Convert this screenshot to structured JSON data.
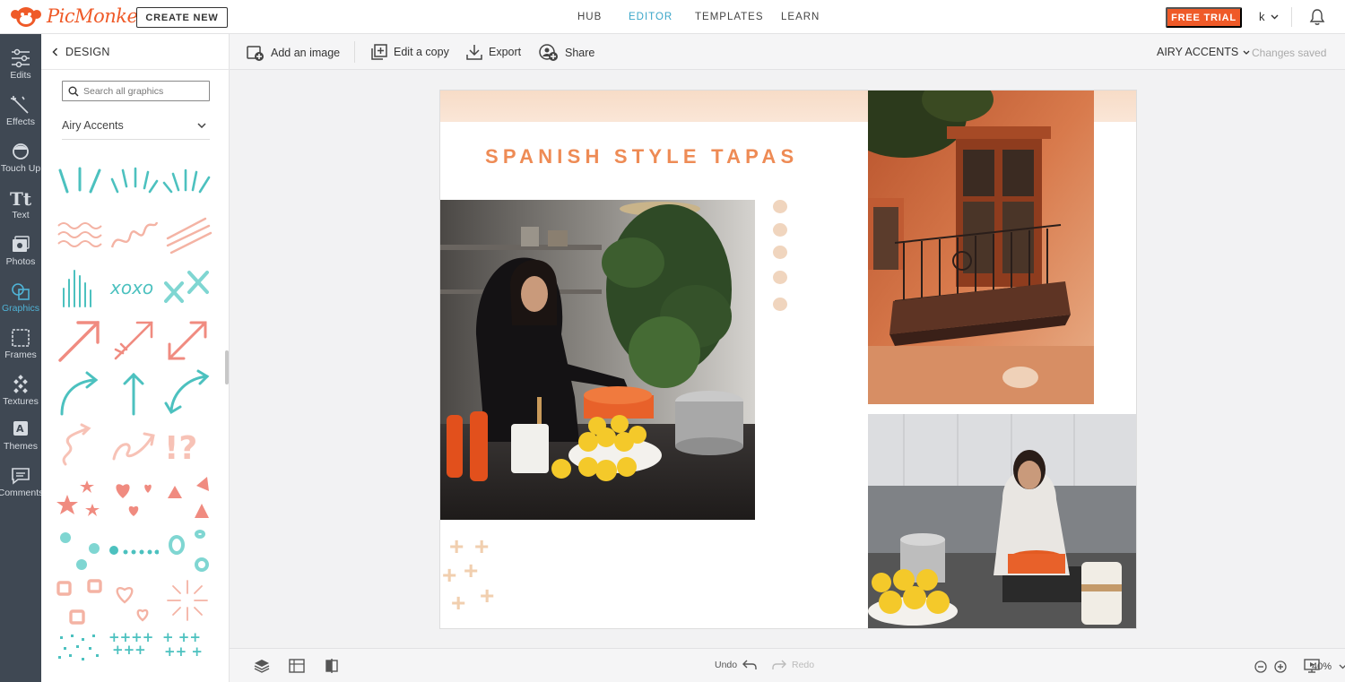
{
  "app": {
    "logo_text": "PicMonkey",
    "brand_color": "#ef5a28",
    "accent_color": "#3aa6c9"
  },
  "topnav": {
    "create_new": "CREATE NEW",
    "links": [
      {
        "label": "HUB",
        "active": false
      },
      {
        "label": "EDITOR",
        "active": true
      },
      {
        "label": "TEMPLATES",
        "active": false
      },
      {
        "label": "LEARN",
        "active": false
      }
    ],
    "free_trial": "FREE TRIAL",
    "user_initial": "k",
    "bell_icon": "bell-icon"
  },
  "rail": {
    "items": [
      {
        "label": "Edits",
        "icon": "sliders-icon"
      },
      {
        "label": "Effects",
        "icon": "magic-wand-icon"
      },
      {
        "label": "Touch Up",
        "icon": "face-icon"
      },
      {
        "label": "Text",
        "icon": "text-icon"
      },
      {
        "label": "Photos",
        "icon": "photos-icon"
      },
      {
        "label": "Graphics",
        "icon": "graphics-icon",
        "active": true
      },
      {
        "label": "Frames",
        "icon": "frame-icon"
      },
      {
        "label": "Textures",
        "icon": "texture-icon"
      },
      {
        "label": "Themes",
        "icon": "themes-icon"
      },
      {
        "label": "Comments",
        "icon": "comment-icon"
      }
    ]
  },
  "panel": {
    "title": "DESIGN",
    "search_placeholder": "Search all graphics",
    "theme_select": "Airy Accents"
  },
  "toolbar": {
    "add_image": "Add an image",
    "edit_copy": "Edit a copy",
    "export": "Export",
    "share": "Share",
    "theme_name": "AIRY ACCENTS",
    "status": "Changes saved"
  },
  "canvas": {
    "title": "SPANISH STYLE TAPAS"
  },
  "bottombar": {
    "undo": "Undo",
    "redo": "Redo",
    "zoom": "40%"
  }
}
